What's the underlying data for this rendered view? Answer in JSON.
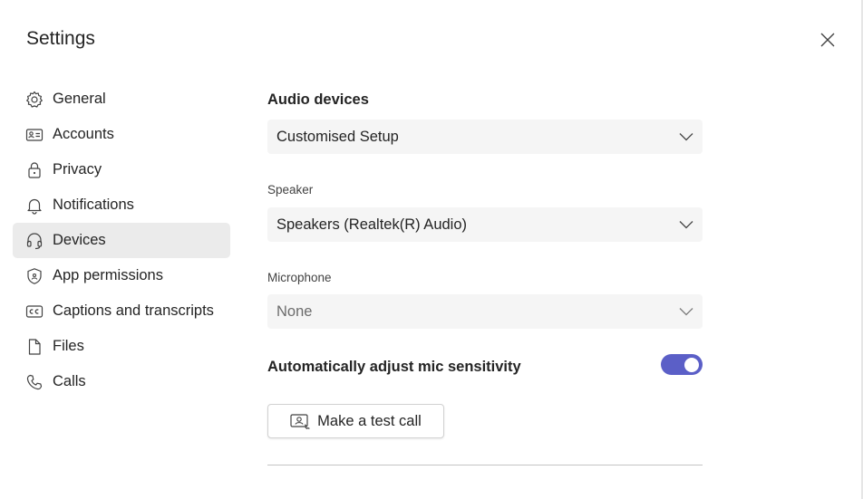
{
  "dialog": {
    "title": "Settings"
  },
  "nav": {
    "items": [
      {
        "label": "General",
        "icon": "gear-icon"
      },
      {
        "label": "Accounts",
        "icon": "id-card-icon"
      },
      {
        "label": "Privacy",
        "icon": "lock-icon"
      },
      {
        "label": "Notifications",
        "icon": "bell-icon"
      },
      {
        "label": "Devices",
        "icon": "headset-icon",
        "active": true
      },
      {
        "label": "App permissions",
        "icon": "shield-icon"
      },
      {
        "label": "Captions and transcripts",
        "icon": "cc-icon"
      },
      {
        "label": "Files",
        "icon": "file-icon"
      },
      {
        "label": "Calls",
        "icon": "phone-icon"
      }
    ]
  },
  "devices": {
    "section_title": "Audio devices",
    "audio_setup_value": "Customised Setup",
    "speaker_label": "Speaker",
    "speaker_value": "Speakers (Realtek(R) Audio)",
    "microphone_label": "Microphone",
    "microphone_value": "None",
    "mic_sensitivity_label": "Automatically adjust mic sensitivity",
    "mic_sensitivity_on": true,
    "test_call_label": "Make a test call"
  },
  "colors": {
    "accent": "#5b5fc7",
    "active_nav_bg": "#ebebeb",
    "dropdown_bg": "#f5f5f5"
  }
}
